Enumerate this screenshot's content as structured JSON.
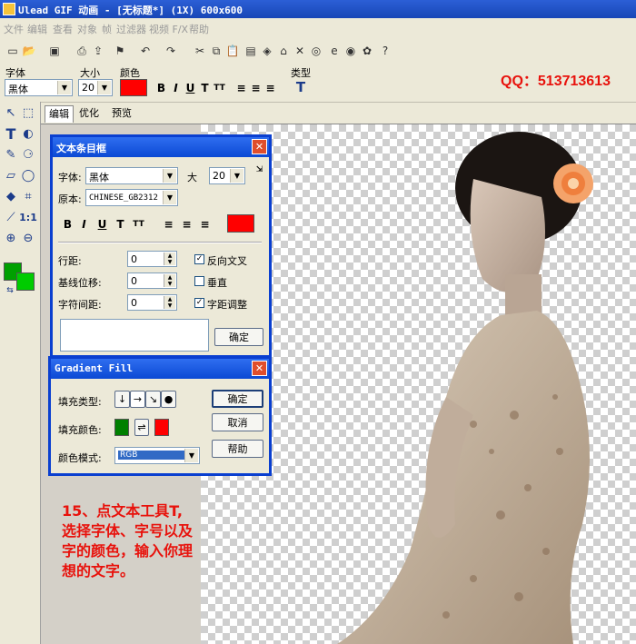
{
  "window": {
    "title": "Ulead GIF 动画 - [无标题*] (1X) 600x600"
  },
  "menu": [
    "文件",
    "编辑",
    "查看",
    "对象",
    "帧",
    "过滤器",
    "视频 F/X",
    "帮助"
  ],
  "toolbar_icons": [
    "new-icon",
    "open-icon",
    "save-icon",
    "print-icon",
    "export-icon",
    "optimize-icon",
    "undo-icon",
    "redo-icon",
    "cut-icon",
    "copy-icon",
    "paste-icon",
    "properties-icon",
    "delete-icon",
    "browser-icon"
  ],
  "attributes": {
    "font_label": "字体",
    "font_value": "黑体",
    "size_label": "大小",
    "size_value": "20",
    "color_label": "颜色",
    "color": "#ff0000",
    "type_label": "类型",
    "format_buttons": [
      "B",
      "I",
      "U",
      "T",
      "TT"
    ]
  },
  "qq": "QQ：513713613",
  "tabs": [
    "编辑",
    "优化",
    "预览"
  ],
  "text_dialog": {
    "title": "文本条目框",
    "font_label": "字体:",
    "font_value": "黑体",
    "size_label": "大",
    "size_value": "20",
    "script_label": "原本:",
    "script_value": "CHINESE_GB2312",
    "color": "#ff0000",
    "line_spacing_label": "行距:",
    "line_spacing": "0",
    "baseline_label": "基线位移:",
    "baseline": "0",
    "char_spacing_label": "字符间距:",
    "char_spacing": "0",
    "antialias_label": "反向文叉",
    "antialias": true,
    "vertical_label": "垂直",
    "vertical": false,
    "kerning_label": "字距调整",
    "kerning": true,
    "ok_label": "确定"
  },
  "gradient_dialog": {
    "title": "Gradient Fill",
    "fill_type_label": "填充类型:",
    "fill_color_label": "填充颜色:",
    "color_mode_label": "颜色模式:",
    "color_mode_value": "RGB",
    "color_start": "#008000",
    "color_end": "#ff0000",
    "ok_label": "确定",
    "cancel_label": "取消",
    "help_label": "帮助"
  },
  "tool_colors": {
    "foreground": "#00a000",
    "background": "#00cc00"
  },
  "note": [
    "15、点文本工具T,",
    "选择字体、字号以及",
    "字的颜色，输入你理",
    "想的文字。"
  ]
}
